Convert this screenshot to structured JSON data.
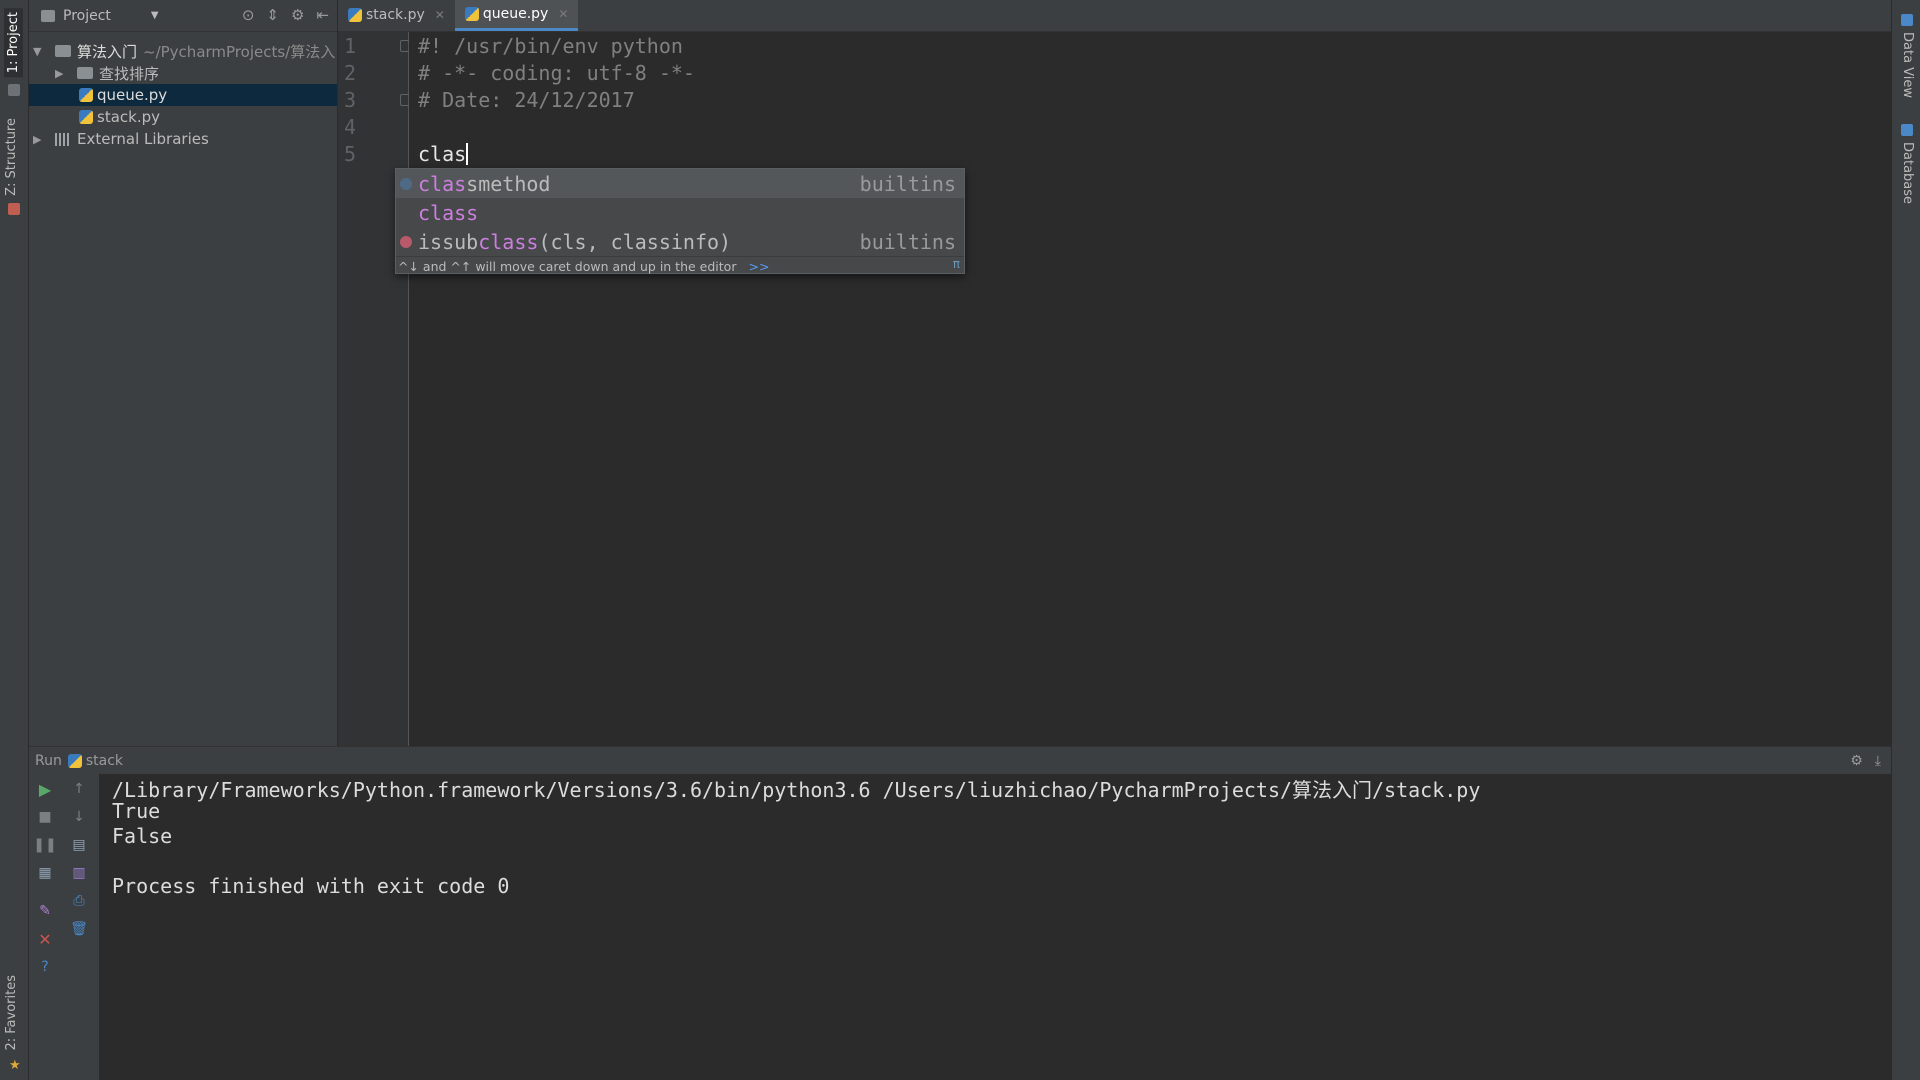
{
  "sidebar_left": {
    "project_tab": "1: Project",
    "structure_tab": "Z: Structure",
    "favorites_tab": "2: Favorites"
  },
  "sidebar_right": {
    "data_view_tab": "Data View",
    "database_tab": "Database"
  },
  "project_panel": {
    "title": "Project",
    "root_name": "算法入门",
    "root_path": "~/PycharmProjects/算法入",
    "folder": "查找排序",
    "files": [
      "queue.py",
      "stack.py"
    ],
    "external": "External Libraries"
  },
  "tabs": [
    {
      "label": "stack.py"
    },
    {
      "label": "queue.py"
    }
  ],
  "editor": {
    "line_numbers": [
      "1",
      "2",
      "3",
      "4",
      "5"
    ],
    "lines": [
      "#! /usr/bin/env python",
      "# -*- coding: utf-8 -*-",
      "# Date: 24/12/2017",
      "",
      "clas"
    ]
  },
  "completion": {
    "items": [
      {
        "match": "clas",
        "rest": "smethod",
        "source": "builtins"
      },
      {
        "match": "clas",
        "rest": "s",
        "source": ""
      },
      {
        "prefix": "issub",
        "match": "class",
        "rest": "(cls, classinfo)",
        "source": "builtins"
      }
    ],
    "hint": "^↓ and ^↑ will move caret down and up in the editor",
    "hint_link": ">>",
    "pi": "π"
  },
  "run": {
    "label": "Run",
    "config": "stack",
    "output": [
      "/Library/Frameworks/Python.framework/Versions/3.6/bin/python3.6 /Users/liuzhichao/PycharmProjects/算法入门/stack.py",
      "True",
      "False",
      "",
      "Process finished with exit code 0"
    ]
  },
  "colors": {
    "accent": "#4a88c7",
    "match": "#cc7fde",
    "selection": "#0d293e"
  }
}
